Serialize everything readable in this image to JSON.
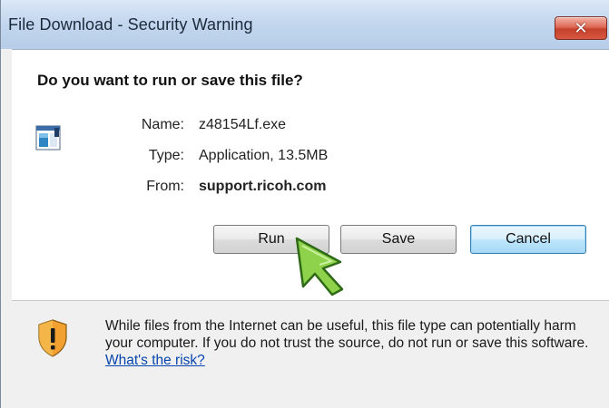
{
  "window": {
    "title": "File Download - Security Warning",
    "close_label": "✕"
  },
  "question": "Do you want to run or save this file?",
  "file_info": {
    "name_label": "Name:",
    "name_value": "z48154Lf.exe",
    "type_label": "Type:",
    "type_value": "Application, 13.5MB",
    "from_label": "From:",
    "from_value": "support.ricoh.com"
  },
  "buttons": {
    "run": "Run",
    "save": "Save",
    "cancel": "Cancel"
  },
  "warning": {
    "text": "While files from the Internet can be useful, this file type can potentially harm your computer. If you do not trust the source, do not run or save this software.",
    "link": "What's the risk?"
  },
  "icons": {
    "file": "application-file-icon",
    "shield": "warning-shield-icon",
    "cursor": "arrow-cursor-icon"
  },
  "colors": {
    "cursor_fill": "#8ed24c",
    "shield_orange": "#f2a030",
    "close_red": "#c5422d",
    "link": "#0645ad"
  }
}
